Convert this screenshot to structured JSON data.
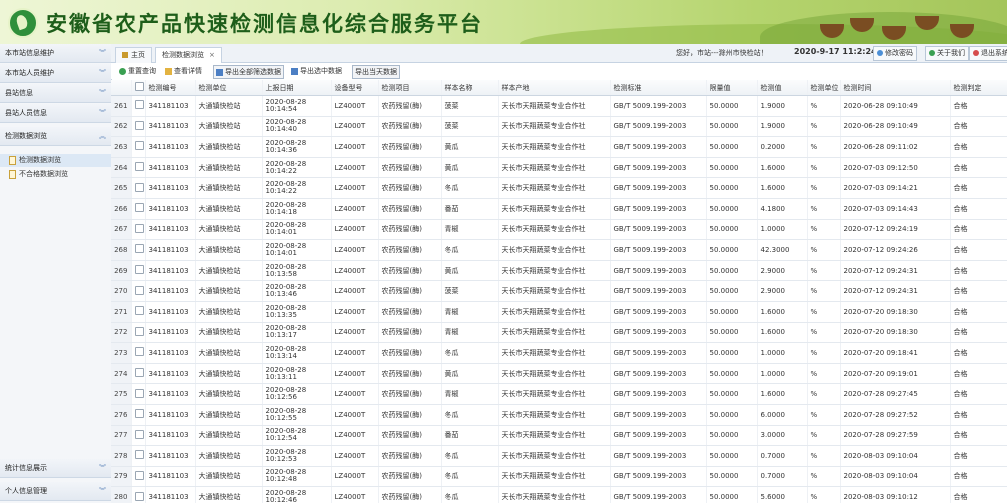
{
  "banner": {
    "title": "安徽省农产品快速检测信息化综合服务平台"
  },
  "tabs": [
    {
      "label": "主页"
    },
    {
      "label": "检测数据浏览"
    }
  ],
  "header": {
    "greeting": "您好，市站---滁州市快检站！",
    "datetime": "2020-9-17 11:2:24",
    "buttons": [
      {
        "label": "修改密码"
      },
      {
        "label": "关于我们"
      },
      {
        "label": "退出系统"
      }
    ]
  },
  "sidebar": {
    "items": [
      {
        "label": "本市站信息维护"
      },
      {
        "label": "本市站人员维护"
      },
      {
        "label": "县站信息"
      },
      {
        "label": "县站人员信息"
      },
      {
        "label": "检测数据浏览"
      }
    ],
    "subitems": [
      {
        "label": "检测数据浏览"
      },
      {
        "label": "不合格数据浏览"
      }
    ],
    "bottom": [
      {
        "label": "统计信息展示"
      },
      {
        "label": "个人信息管理"
      }
    ]
  },
  "toolbar": {
    "reset": "重置查询",
    "query": "查看详情",
    "export_all": "导出全部筛选数据",
    "export_selected": "导出选中数据",
    "export_today": "导出当天数据"
  },
  "columns": [
    "",
    "",
    "检测编号",
    "检测单位",
    "上报日期",
    "设备型号",
    "检测项目",
    "样本名称",
    "样本产地",
    "检测标准",
    "限量值",
    "检测值",
    "检测单位",
    "检测时间",
    "检测判定"
  ],
  "rows": [
    [
      "261",
      "341181103",
      "大通镇快检站",
      "2020-08-28 10:14:54",
      "LZ4000T",
      "农药残留(酶)",
      "菠菜",
      "天长市天翔蔬菜专业合作社",
      "GB/T 5009.199-2003",
      "50.0000",
      "1.9000",
      "%",
      "2020-06-28 09:10:49",
      "合格"
    ],
    [
      "262",
      "341181103",
      "大通镇快检站",
      "2020-08-28 10:14:40",
      "LZ4000T",
      "农药残留(酶)",
      "菠菜",
      "天长市天翔蔬菜专业合作社",
      "GB/T 5009.199-2003",
      "50.0000",
      "1.9000",
      "%",
      "2020-06-28 09:10:49",
      "合格"
    ],
    [
      "263",
      "341181103",
      "大通镇快检站",
      "2020-08-28 10:14:36",
      "LZ4000T",
      "农药残留(酶)",
      "黄瓜",
      "天长市天翔蔬菜专业合作社",
      "GB/T 5009.199-2003",
      "50.0000",
      "0.2000",
      "%",
      "2020-06-28 09:11:02",
      "合格"
    ],
    [
      "264",
      "341181103",
      "大通镇快检站",
      "2020-08-28 10:14:22",
      "LZ4000T",
      "农药残留(酶)",
      "黄瓜",
      "天长市天翔蔬菜专业合作社",
      "GB/T 5009.199-2003",
      "50.0000",
      "1.6000",
      "%",
      "2020-07-03 09:12:50",
      "合格"
    ],
    [
      "265",
      "341181103",
      "大通镇快检站",
      "2020-08-28 10:14:22",
      "LZ4000T",
      "农药残留(酶)",
      "冬瓜",
      "天长市天翔蔬菜专业合作社",
      "GB/T 5009.199-2003",
      "50.0000",
      "1.6000",
      "%",
      "2020-07-03 09:14:21",
      "合格"
    ],
    [
      "266",
      "341181103",
      "大通镇快检站",
      "2020-08-28 10:14:18",
      "LZ4000T",
      "农药残留(酶)",
      "番茄",
      "天长市天翔蔬菜专业合作社",
      "GB/T 5009.199-2003",
      "50.0000",
      "4.1800",
      "%",
      "2020-07-03 09:14:43",
      "合格"
    ],
    [
      "267",
      "341181103",
      "大通镇快检站",
      "2020-08-28 10:14:01",
      "LZ4000T",
      "农药残留(酶)",
      "青椒",
      "天长市天翔蔬菜专业合作社",
      "GB/T 5009.199-2003",
      "50.0000",
      "1.0000",
      "%",
      "2020-07-12 09:24:19",
      "合格"
    ],
    [
      "268",
      "341181103",
      "大通镇快检站",
      "2020-08-28 10:14:01",
      "LZ4000T",
      "农药残留(酶)",
      "冬瓜",
      "天长市天翔蔬菜专业合作社",
      "GB/T 5009.199-2003",
      "50.0000",
      "42.3000",
      "%",
      "2020-07-12 09:24:26",
      "合格"
    ],
    [
      "269",
      "341181103",
      "大通镇快检站",
      "2020-08-28 10:13:58",
      "LZ4000T",
      "农药残留(酶)",
      "黄瓜",
      "天长市天翔蔬菜专业合作社",
      "GB/T 5009.199-2003",
      "50.0000",
      "2.9000",
      "%",
      "2020-07-12 09:24:31",
      "合格"
    ],
    [
      "270",
      "341181103",
      "大通镇快检站",
      "2020-08-28 10:13:46",
      "LZ4000T",
      "农药残留(酶)",
      "菠菜",
      "天长市天翔蔬菜专业合作社",
      "GB/T 5009.199-2003",
      "50.0000",
      "2.9000",
      "%",
      "2020-07-12 09:24:31",
      "合格"
    ],
    [
      "271",
      "341181103",
      "大通镇快检站",
      "2020-08-28 10:13:35",
      "LZ4000T",
      "农药残留(酶)",
      "青椒",
      "天长市天翔蔬菜专业合作社",
      "GB/T 5009.199-2003",
      "50.0000",
      "1.6000",
      "%",
      "2020-07-20 09:18:30",
      "合格"
    ],
    [
      "272",
      "341181103",
      "大通镇快检站",
      "2020-08-28 10:13:17",
      "LZ4000T",
      "农药残留(酶)",
      "青椒",
      "天长市天翔蔬菜专业合作社",
      "GB/T 5009.199-2003",
      "50.0000",
      "1.6000",
      "%",
      "2020-07-20 09:18:30",
      "合格"
    ],
    [
      "273",
      "341181103",
      "大通镇快检站",
      "2020-08-28 10:13:14",
      "LZ4000T",
      "农药残留(酶)",
      "冬瓜",
      "天长市天翔蔬菜专业合作社",
      "GB/T 5009.199-2003",
      "50.0000",
      "1.0000",
      "%",
      "2020-07-20 09:18:41",
      "合格"
    ],
    [
      "274",
      "341181103",
      "大通镇快检站",
      "2020-08-28 10:13:11",
      "LZ4000T",
      "农药残留(酶)",
      "黄瓜",
      "天长市天翔蔬菜专业合作社",
      "GB/T 5009.199-2003",
      "50.0000",
      "1.0000",
      "%",
      "2020-07-20 09:19:01",
      "合格"
    ],
    [
      "275",
      "341181103",
      "大通镇快检站",
      "2020-08-28 10:12:56",
      "LZ4000T",
      "农药残留(酶)",
      "青椒",
      "天长市天翔蔬菜专业合作社",
      "GB/T 5009.199-2003",
      "50.0000",
      "1.6000",
      "%",
      "2020-07-28 09:27:45",
      "合格"
    ],
    [
      "276",
      "341181103",
      "大通镇快检站",
      "2020-08-28 10:12:55",
      "LZ4000T",
      "农药残留(酶)",
      "冬瓜",
      "天长市天翔蔬菜专业合作社",
      "GB/T 5009.199-2003",
      "50.0000",
      "6.0000",
      "%",
      "2020-07-28 09:27:52",
      "合格"
    ],
    [
      "277",
      "341181103",
      "大通镇快检站",
      "2020-08-28 10:12:54",
      "LZ4000T",
      "农药残留(酶)",
      "番茄",
      "天长市天翔蔬菜专业合作社",
      "GB/T 5009.199-2003",
      "50.0000",
      "3.0000",
      "%",
      "2020-07-28 09:27:59",
      "合格"
    ],
    [
      "278",
      "341181103",
      "大通镇快检站",
      "2020-08-28 10:12:53",
      "LZ4000T",
      "农药残留(酶)",
      "冬瓜",
      "天长市天翔蔬菜专业合作社",
      "GB/T 5009.199-2003",
      "50.0000",
      "0.7000",
      "%",
      "2020-08-03 09:10:04",
      "合格"
    ],
    [
      "279",
      "341181103",
      "大通镇快检站",
      "2020-08-28 10:12:48",
      "LZ4000T",
      "农药残留(酶)",
      "冬瓜",
      "天长市天翔蔬菜专业合作社",
      "GB/T 5009.199-2003",
      "50.0000",
      "0.7000",
      "%",
      "2020-08-03 09:10:04",
      "合格"
    ],
    [
      "280",
      "341181103",
      "大通镇快检站",
      "2020-08-28 10:12:46",
      "LZ4000T",
      "农药残留(酶)",
      "冬瓜",
      "天长市天翔蔬菜专业合作社",
      "GB/T 5009.199-2003",
      "50.0000",
      "5.6000",
      "%",
      "2020-08-03 09:10:12",
      "合格"
    ]
  ]
}
